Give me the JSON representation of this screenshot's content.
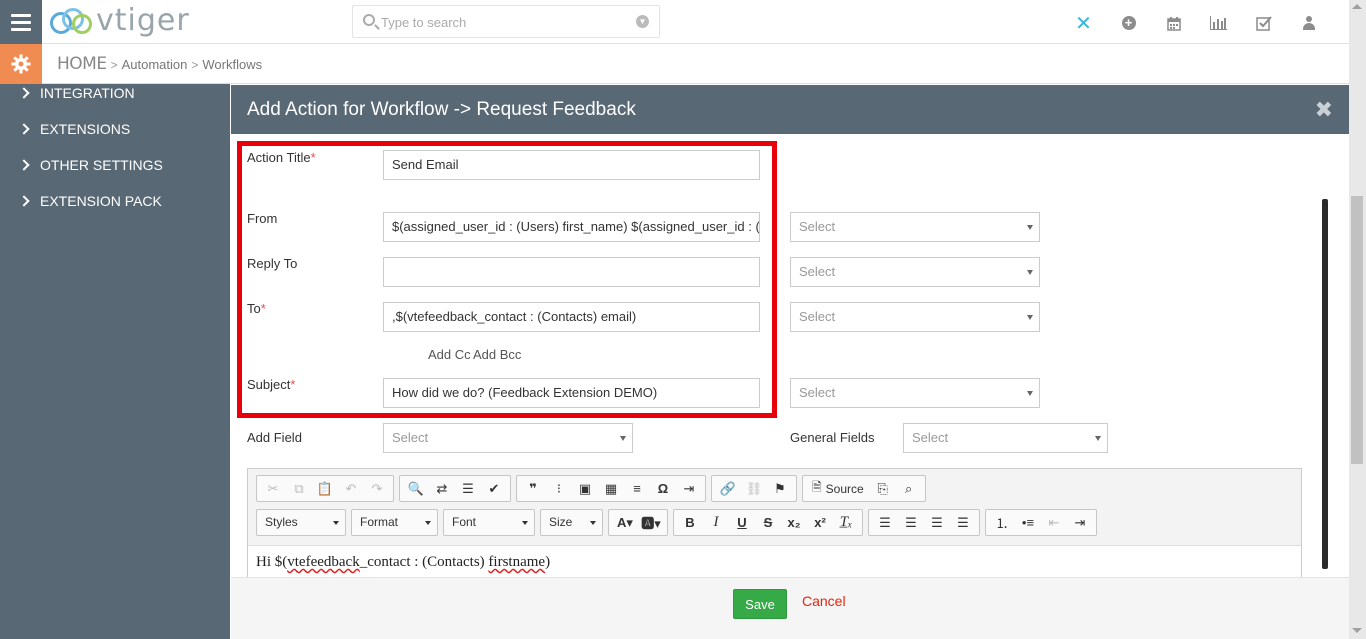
{
  "app": {
    "logo_text": "vtiger",
    "search_placeholder": "Type to search"
  },
  "breadcrumb": {
    "home": "HOME",
    "sep": ">",
    "items": [
      "Automation",
      "Workflows"
    ]
  },
  "sidebar": {
    "items": [
      {
        "label": "INTEGRATION"
      },
      {
        "label": "EXTENSIONS"
      },
      {
        "label": "OTHER SETTINGS"
      },
      {
        "label": "EXTENSION PACK"
      }
    ]
  },
  "modal": {
    "title": "Add Action for Workflow -> Request Feedback",
    "close_glyph": "✖"
  },
  "form": {
    "action_title": {
      "label": "Action Title",
      "value": "Send Email"
    },
    "from": {
      "label": "From",
      "value": "$(assigned_user_id : (Users) first_name) $(assigned_user_id : (Users) last_name)",
      "select": "Select"
    },
    "reply_to": {
      "label": "Reply To",
      "value": "",
      "select": "Select"
    },
    "to": {
      "label": "To",
      "value": ",$(vtefeedback_contact : (Contacts) email)",
      "select": "Select"
    },
    "add_cc": "Add Cc",
    "add_bcc": "Add Bcc",
    "subject": {
      "label": "Subject",
      "value": "How did we do? (Feedback Extension DEMO)",
      "select": "Select"
    },
    "add_field": {
      "label": "Add Field",
      "select": "Select"
    },
    "general_fields": {
      "label": "General Fields",
      "select": "Select"
    },
    "required_mark": "*"
  },
  "editor": {
    "source_label": "Source",
    "combos": [
      "Styles",
      "Format",
      "Font",
      "Size"
    ],
    "content_prefix": "Hi $(",
    "content_word1": "vtefeedback",
    "content_mid": "_contact : (Contacts) ",
    "content_word2": "firstname",
    "content_suffix": ")"
  },
  "footer": {
    "save": "Save",
    "cancel": "Cancel"
  },
  "colors": {
    "sidebar": "#596875",
    "accent_orange": "#f08c52",
    "highlight_red": "#e8000a",
    "save_green": "#35aa47",
    "cancel_red": "#e4260c"
  }
}
